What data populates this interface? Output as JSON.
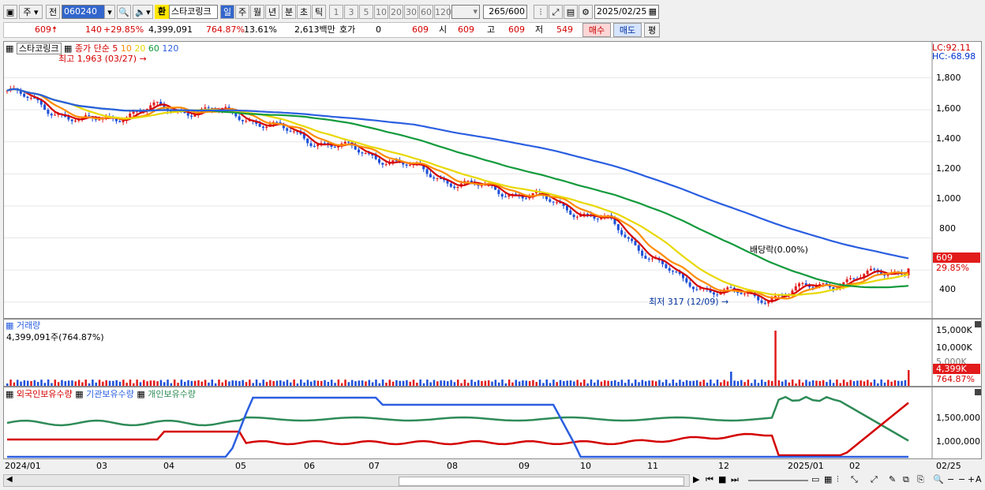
{
  "toolbar": {
    "market_type": "주",
    "prev_label": "전",
    "stock_code": "060240",
    "currency_badge": "환",
    "stock_name": "스타코링크",
    "periods": [
      "일",
      "주",
      "월",
      "년",
      "분",
      "초",
      "틱"
    ],
    "active_period": "일",
    "intervals": [
      "1",
      "3",
      "5",
      "10",
      "20",
      "30",
      "60",
      "120"
    ],
    "count": "265",
    "count_total": "/600",
    "date": "2025/02/25"
  },
  "quote": {
    "price": "609",
    "change": "140",
    "change_pct": "+29.85%",
    "volume": "4,399,091",
    "volume_ratio": "764.87%",
    "turnover_rate": "13.61%",
    "amount": "2,613백만",
    "hoga_label": "호가",
    "hoga_value": "0",
    "hoga_price": "609",
    "open_label": "시",
    "open": "609",
    "high_label": "고",
    "high": "609",
    "low_label": "저",
    "low": "549",
    "buy_button": "매수",
    "sell_button": "매도",
    "eval_button": "평"
  },
  "price_panel": {
    "stock_label": "스타코링크",
    "ma_label": "종가 단순",
    "ma_periods": [
      "5",
      "10",
      "20",
      "60",
      "120"
    ],
    "ma_colors": [
      "#d40000",
      "#ff8c00",
      "#e8d800",
      "#129a3c",
      "#2b5fe0"
    ],
    "high_marker": "최고 1,963 (03/27)",
    "low_marker": "최저 317 (12/09)",
    "dividend_marker": "배당락(0.00%)",
    "lc_label": "LC:92.11",
    "hc_label": "HC:-68.98",
    "current_price_tag": "609",
    "current_pct_tag": "29.85%",
    "y_ticks": [
      "1,800",
      "1,600",
      "1,400",
      "1,200",
      "1,000",
      "800",
      "600",
      "400"
    ]
  },
  "volume_panel": {
    "title": "거래량",
    "value_label": "4,399,091주(764.87%)",
    "y_ticks": [
      "15,000K",
      "10,000K",
      "5,000K"
    ],
    "current_tag": "4,399K",
    "current_pct": "764.87%"
  },
  "holding_panel": {
    "series": [
      {
        "name": "외국인보유수량",
        "color": "#d40000"
      },
      {
        "name": "기관보유수량",
        "color": "#2b5fe0"
      },
      {
        "name": "개인보유수량",
        "color": "#2e8b57"
      }
    ],
    "y_ticks": [
      "1,500,000",
      "1,000,000"
    ]
  },
  "x_axis": {
    "labels": [
      "2024/01",
      "03",
      "04",
      "05",
      "06",
      "07",
      "08",
      "09",
      "10",
      "11",
      "12",
      "2025/01",
      "02"
    ],
    "end_label": "02/25"
  },
  "chart_data": {
    "type": "line",
    "title": "스타코링크 일봉",
    "y_range": [
      300,
      2000
    ],
    "monthly_close": [
      {
        "month": "2024/01",
        "close": 1720
      },
      {
        "month": "03",
        "close": 1520
      },
      {
        "month": "04",
        "close": 1610
      },
      {
        "month": "05",
        "close": 1580
      },
      {
        "month": "06",
        "close": 1420
      },
      {
        "month": "07",
        "close": 1300
      },
      {
        "month": "08",
        "close": 1140
      },
      {
        "month": "09",
        "close": 1060
      },
      {
        "month": "10",
        "close": 900
      },
      {
        "month": "11",
        "close": 520
      },
      {
        "month": "12",
        "close": 420
      },
      {
        "month": "2025/01",
        "close": 520
      },
      {
        "month": "02",
        "close": 609
      }
    ],
    "high": {
      "value": 1963,
      "date": "03/27"
    },
    "low": {
      "value": 317,
      "date": "12/09"
    }
  }
}
